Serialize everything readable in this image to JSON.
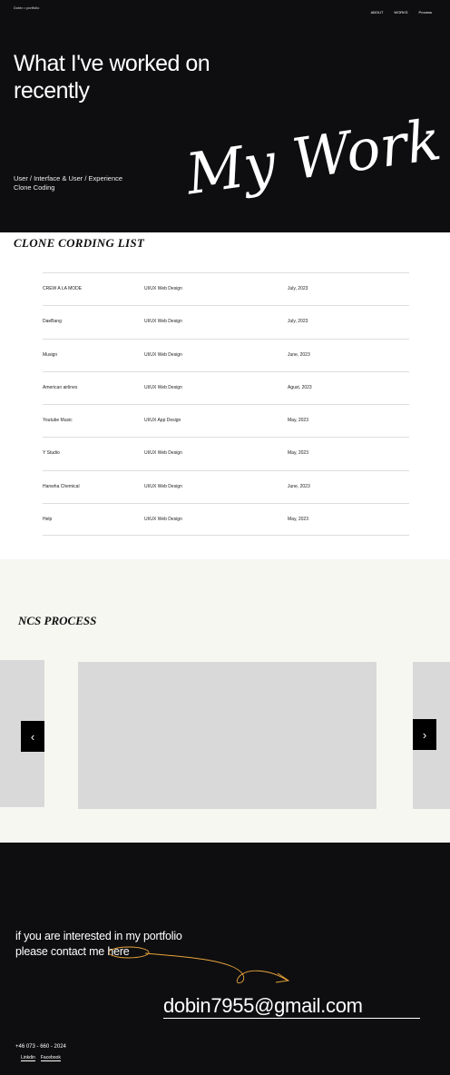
{
  "hero": {
    "logo": "Dobin • portfolio",
    "nav": [
      "ABOUT",
      "WORKS",
      "Process"
    ],
    "title_line1": "What I've worked on",
    "title_line2": "recently",
    "sub_line1": "User / Interface  & User / Experience",
    "sub_line2": "Clone Coding",
    "script_text": "My Work"
  },
  "clone_list": {
    "heading": "CLONE CORDING LIST",
    "rows": [
      {
        "name": "CREW A LA MODE",
        "type": "UI/UX Web Design",
        "date": "July, 2023"
      },
      {
        "name": "DaeBang",
        "type": "UI/UX Web Design",
        "date": "July, 2023"
      },
      {
        "name": "Musign",
        "type": "UI/UX Web Design",
        "date": "June, 2023"
      },
      {
        "name": "American airlines",
        "type": "UI/UX Web Design",
        "date": "Agust, 2023"
      },
      {
        "name": "Youtube Music",
        "type": "UI/UX App Design",
        "date": "May, 2023"
      },
      {
        "name": "Y Studio",
        "type": "UI/UX Web Design",
        "date": "May, 2023"
      },
      {
        "name": "Hanwha Chemical",
        "type": "UI/UX Web Design",
        "date": "June, 2023"
      },
      {
        "name": "Help",
        "type": "UI/UX Web Design",
        "date": "May, 2023"
      }
    ]
  },
  "process": {
    "heading": "NCS PROCESS",
    "prev_icon": "chevron-left-icon",
    "next_icon": "chevron-right-icon",
    "prev_glyph": "‹",
    "next_glyph": "›"
  },
  "contact": {
    "line1": "if you are interested in my portfolio",
    "line2_prefix": "please contact me ",
    "line2_link": "here",
    "email": "dobin7955@gmail.com",
    "phone": "+46 073 - 660 - 2024",
    "social": [
      "Linkdin",
      "Facebook"
    ],
    "accent_color": "#e8a33a"
  }
}
